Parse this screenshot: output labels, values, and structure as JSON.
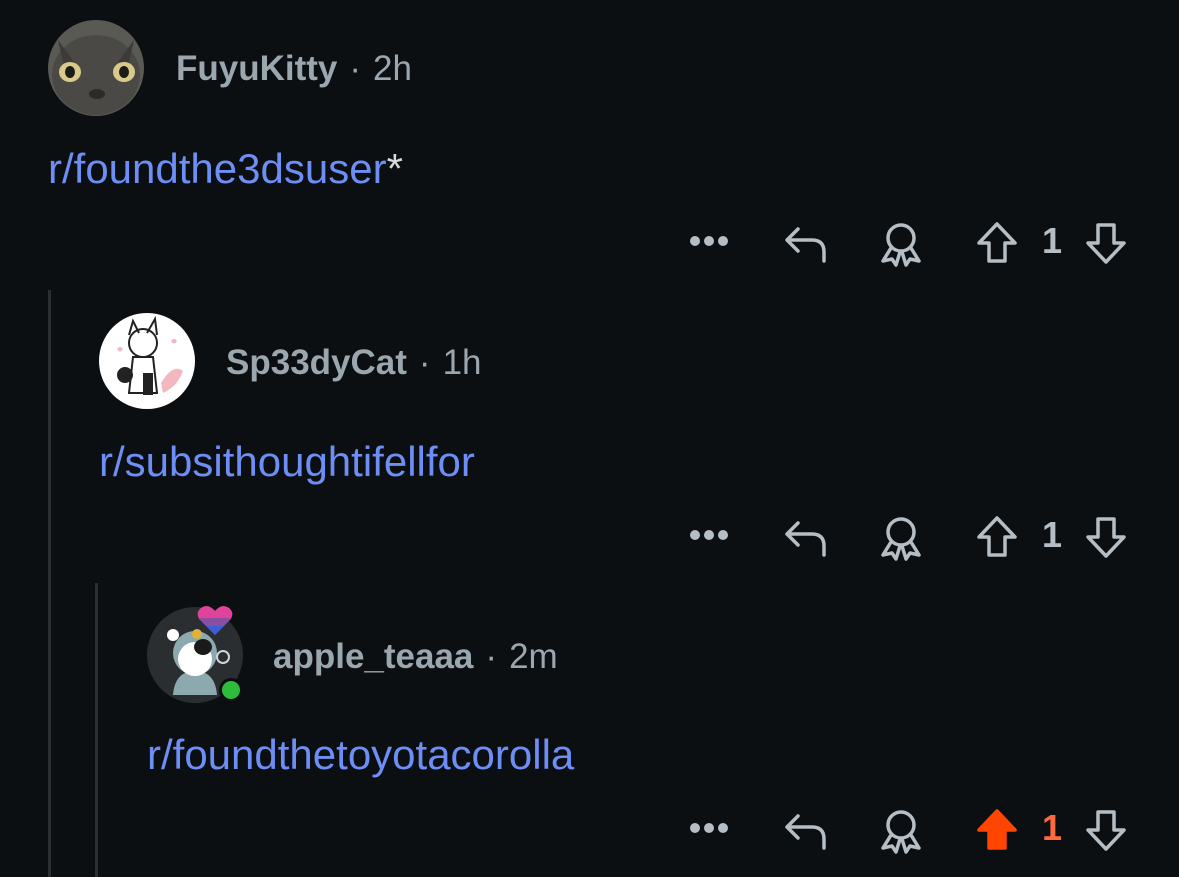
{
  "comments": [
    {
      "username": "FuyuKitty",
      "separator": "·",
      "age": "2h",
      "text": "r/foundthe3dsuser",
      "suffix": "*",
      "score": "1",
      "vote": "none"
    },
    {
      "username": "Sp33dyCat",
      "separator": "·",
      "age": "1h",
      "text": "r/subsithoughtifellfor",
      "suffix": "",
      "score": "1",
      "vote": "none"
    },
    {
      "username": "apple_teaaa",
      "separator": "·",
      "age": "2m",
      "text": "r/foundthetoyotacorolla",
      "suffix": "",
      "score": "1",
      "vote": "upvoted",
      "online": true
    }
  ],
  "colors": {
    "background": "#0c0f12",
    "link": "#6d8ef5",
    "meta": "#9aa7ae",
    "upvote_active": "#ff4500",
    "online": "#2ebd3b"
  },
  "icons": [
    "more-icon",
    "reply-icon",
    "award-icon",
    "upvote-icon",
    "downvote-icon"
  ]
}
